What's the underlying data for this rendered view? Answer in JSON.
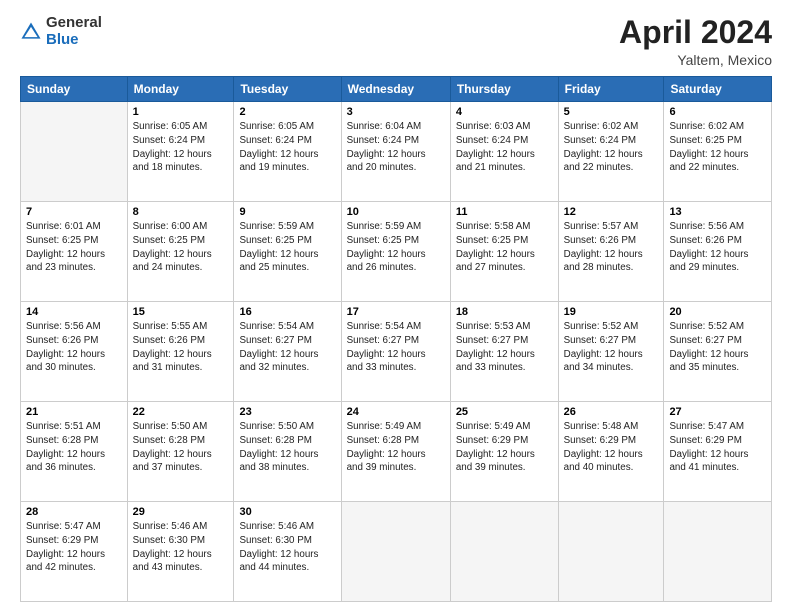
{
  "header": {
    "logo_general": "General",
    "logo_blue": "Blue",
    "month_title": "April 2024",
    "location": "Yaltem, Mexico"
  },
  "weekdays": [
    "Sunday",
    "Monday",
    "Tuesday",
    "Wednesday",
    "Thursday",
    "Friday",
    "Saturday"
  ],
  "weeks": [
    [
      {
        "day": "",
        "info": ""
      },
      {
        "day": "1",
        "info": "Sunrise: 6:05 AM\nSunset: 6:24 PM\nDaylight: 12 hours\nand 18 minutes."
      },
      {
        "day": "2",
        "info": "Sunrise: 6:05 AM\nSunset: 6:24 PM\nDaylight: 12 hours\nand 19 minutes."
      },
      {
        "day": "3",
        "info": "Sunrise: 6:04 AM\nSunset: 6:24 PM\nDaylight: 12 hours\nand 20 minutes."
      },
      {
        "day": "4",
        "info": "Sunrise: 6:03 AM\nSunset: 6:24 PM\nDaylight: 12 hours\nand 21 minutes."
      },
      {
        "day": "5",
        "info": "Sunrise: 6:02 AM\nSunset: 6:24 PM\nDaylight: 12 hours\nand 22 minutes."
      },
      {
        "day": "6",
        "info": "Sunrise: 6:02 AM\nSunset: 6:25 PM\nDaylight: 12 hours\nand 22 minutes."
      }
    ],
    [
      {
        "day": "7",
        "info": "Sunrise: 6:01 AM\nSunset: 6:25 PM\nDaylight: 12 hours\nand 23 minutes."
      },
      {
        "day": "8",
        "info": "Sunrise: 6:00 AM\nSunset: 6:25 PM\nDaylight: 12 hours\nand 24 minutes."
      },
      {
        "day": "9",
        "info": "Sunrise: 5:59 AM\nSunset: 6:25 PM\nDaylight: 12 hours\nand 25 minutes."
      },
      {
        "day": "10",
        "info": "Sunrise: 5:59 AM\nSunset: 6:25 PM\nDaylight: 12 hours\nand 26 minutes."
      },
      {
        "day": "11",
        "info": "Sunrise: 5:58 AM\nSunset: 6:25 PM\nDaylight: 12 hours\nand 27 minutes."
      },
      {
        "day": "12",
        "info": "Sunrise: 5:57 AM\nSunset: 6:26 PM\nDaylight: 12 hours\nand 28 minutes."
      },
      {
        "day": "13",
        "info": "Sunrise: 5:56 AM\nSunset: 6:26 PM\nDaylight: 12 hours\nand 29 minutes."
      }
    ],
    [
      {
        "day": "14",
        "info": "Sunrise: 5:56 AM\nSunset: 6:26 PM\nDaylight: 12 hours\nand 30 minutes."
      },
      {
        "day": "15",
        "info": "Sunrise: 5:55 AM\nSunset: 6:26 PM\nDaylight: 12 hours\nand 31 minutes."
      },
      {
        "day": "16",
        "info": "Sunrise: 5:54 AM\nSunset: 6:27 PM\nDaylight: 12 hours\nand 32 minutes."
      },
      {
        "day": "17",
        "info": "Sunrise: 5:54 AM\nSunset: 6:27 PM\nDaylight: 12 hours\nand 33 minutes."
      },
      {
        "day": "18",
        "info": "Sunrise: 5:53 AM\nSunset: 6:27 PM\nDaylight: 12 hours\nand 33 minutes."
      },
      {
        "day": "19",
        "info": "Sunrise: 5:52 AM\nSunset: 6:27 PM\nDaylight: 12 hours\nand 34 minutes."
      },
      {
        "day": "20",
        "info": "Sunrise: 5:52 AM\nSunset: 6:27 PM\nDaylight: 12 hours\nand 35 minutes."
      }
    ],
    [
      {
        "day": "21",
        "info": "Sunrise: 5:51 AM\nSunset: 6:28 PM\nDaylight: 12 hours\nand 36 minutes."
      },
      {
        "day": "22",
        "info": "Sunrise: 5:50 AM\nSunset: 6:28 PM\nDaylight: 12 hours\nand 37 minutes."
      },
      {
        "day": "23",
        "info": "Sunrise: 5:50 AM\nSunset: 6:28 PM\nDaylight: 12 hours\nand 38 minutes."
      },
      {
        "day": "24",
        "info": "Sunrise: 5:49 AM\nSunset: 6:28 PM\nDaylight: 12 hours\nand 39 minutes."
      },
      {
        "day": "25",
        "info": "Sunrise: 5:49 AM\nSunset: 6:29 PM\nDaylight: 12 hours\nand 39 minutes."
      },
      {
        "day": "26",
        "info": "Sunrise: 5:48 AM\nSunset: 6:29 PM\nDaylight: 12 hours\nand 40 minutes."
      },
      {
        "day": "27",
        "info": "Sunrise: 5:47 AM\nSunset: 6:29 PM\nDaylight: 12 hours\nand 41 minutes."
      }
    ],
    [
      {
        "day": "28",
        "info": "Sunrise: 5:47 AM\nSunset: 6:29 PM\nDaylight: 12 hours\nand 42 minutes."
      },
      {
        "day": "29",
        "info": "Sunrise: 5:46 AM\nSunset: 6:30 PM\nDaylight: 12 hours\nand 43 minutes."
      },
      {
        "day": "30",
        "info": "Sunrise: 5:46 AM\nSunset: 6:30 PM\nDaylight: 12 hours\nand 44 minutes."
      },
      {
        "day": "",
        "info": ""
      },
      {
        "day": "",
        "info": ""
      },
      {
        "day": "",
        "info": ""
      },
      {
        "day": "",
        "info": ""
      }
    ]
  ]
}
